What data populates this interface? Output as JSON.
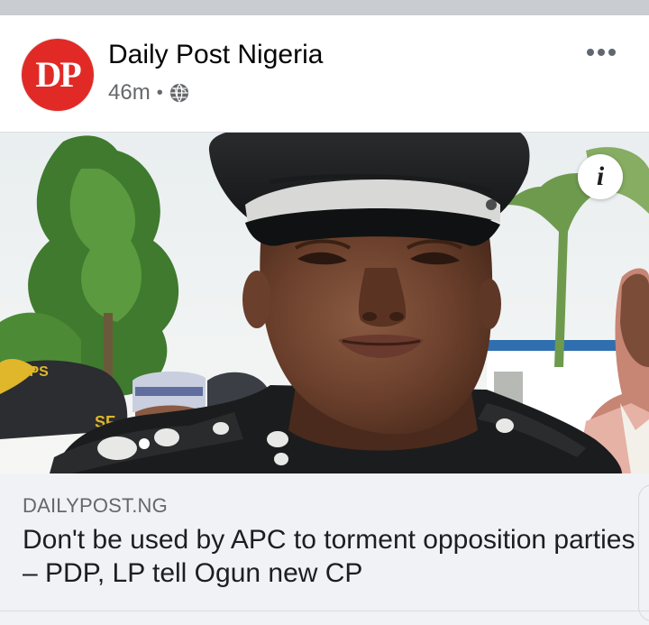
{
  "post": {
    "avatar_text": "DP",
    "page_name": "Daily Post Nigeria",
    "time": "46m",
    "separator": "•",
    "privacy_icon": "globe-icon",
    "more_icon": "more-dots-icon"
  },
  "image": {
    "description_icon": "info-icon",
    "info_label": "i"
  },
  "link": {
    "domain": "DAILYPOST.NG",
    "title": "Don't be used by APC to torment opposition parties – PDP, LP tell Ogun new CP"
  },
  "colors": {
    "brand_red": "#e12a26",
    "meta_gray": "#65676b",
    "link_bg": "#f0f2f5"
  }
}
